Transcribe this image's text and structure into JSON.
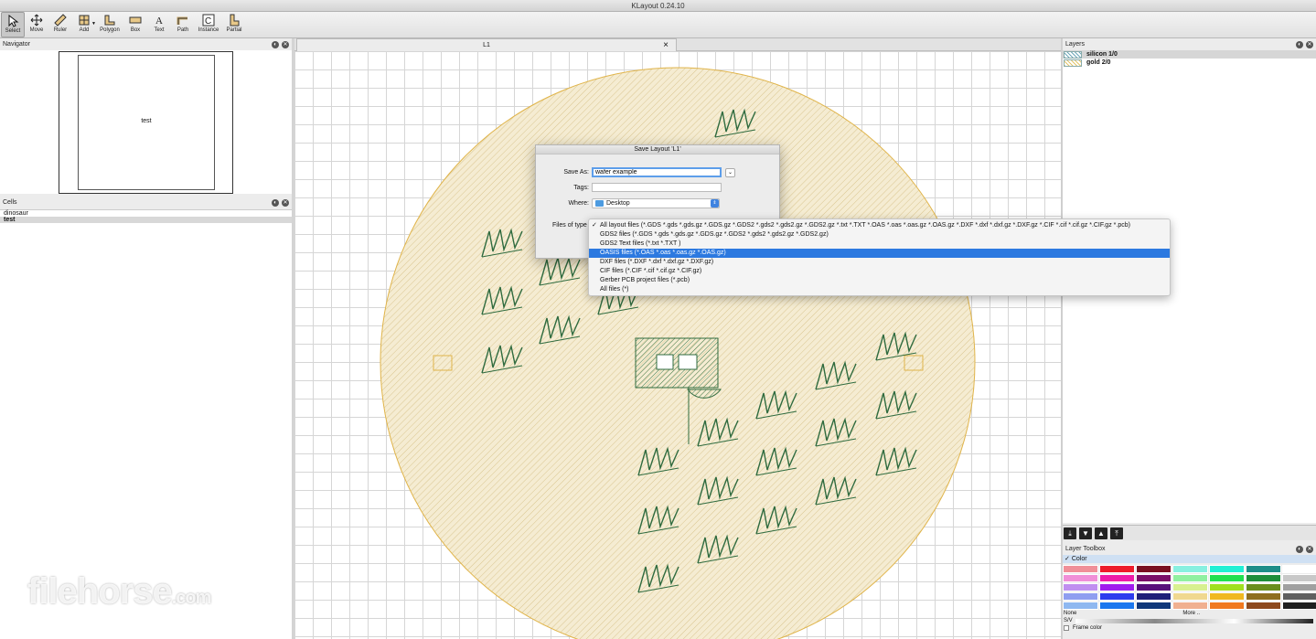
{
  "window": {
    "title": "KLayout 0.24.10"
  },
  "toolbar": {
    "tools": [
      {
        "label": "Select",
        "icon": "arrow-cursor-icon",
        "active": true
      },
      {
        "label": "Move",
        "icon": "move-icon"
      },
      {
        "label": "Ruler",
        "icon": "ruler-icon"
      },
      {
        "label": "Add",
        "icon": "add-grid-icon"
      },
      {
        "label": "Polygon",
        "icon": "polygon-icon"
      },
      {
        "label": "Box",
        "icon": "box-icon"
      },
      {
        "label": "Text",
        "icon": "text-icon"
      },
      {
        "label": "Path",
        "icon": "path-icon"
      },
      {
        "label": "Instance",
        "icon": "instance-icon"
      },
      {
        "label": "Partial",
        "icon": "partial-icon"
      }
    ]
  },
  "navigator": {
    "title": "Navigator",
    "cell_label": "test"
  },
  "cells": {
    "title": "Cells",
    "items": [
      {
        "name": "dinosaur",
        "selected": false
      },
      {
        "name": "test",
        "selected": true
      }
    ]
  },
  "layout_tab": {
    "label": "L1",
    "close": "×"
  },
  "layers": {
    "title": "Layers",
    "items": [
      {
        "name": "silicon 1/0",
        "color": "#6fa8b8",
        "selected": true
      },
      {
        "name": "gold 2/0",
        "color": "#e2c56b",
        "selected": false
      }
    ],
    "buttons": [
      "⤓",
      "▼",
      "▲",
      "⤒"
    ]
  },
  "layer_toolbox": {
    "title": "Layer Toolbox",
    "color_section": "Color",
    "palette": [
      "#f08f98",
      "#ee1c2a",
      "#7a1020",
      "#88f0e0",
      "#21f0d4",
      "#1e8e88",
      "#ffffff",
      "#f08fd8",
      "#ee1ca8",
      "#7a1068",
      "#90f0a0",
      "#21e050",
      "#1e8e3a",
      "#c8c8c8",
      "#c08ff0",
      "#a01cee",
      "#58107a",
      "#d8f090",
      "#a0e020",
      "#6a8e1e",
      "#a0a0a0",
      "#8f9ef0",
      "#2c3cee",
      "#1e207a",
      "#f0d890",
      "#f0b820",
      "#8e6e1e",
      "#606060",
      "#8fb8f0",
      "#1c78ee",
      "#10387a",
      "#f0b090",
      "#f07a20",
      "#8e4a1e",
      "#202020"
    ],
    "none_label": "None",
    "more_label": "More ..",
    "sv_label": "S/V",
    "frame_color_label": "Frame color"
  },
  "save_dialog": {
    "title": "Save Layout 'L1'",
    "save_as_label": "Save As:",
    "save_as_value": "wafer example",
    "tags_label": "Tags:",
    "where_label": "Where:",
    "where_value": "Desktop",
    "files_of_type_label": "Files of type"
  },
  "file_types": {
    "options": [
      {
        "text": "All layout files (*.GDS *.gds *.gds.gz *.GDS.gz *.GDS2 *.gds2 *.gds2.gz *.GDS2.gz *.txt *.TXT *.OAS *.oas *.oas.gz *.OAS.gz *.DXF *.dxf *.dxf.gz *.DXF.gz *.CIF *.cif *.cif.gz *.CIF.gz *.pcb)",
        "checked": true
      },
      {
        "text": "GDS2 files (*.GDS *.gds *.gds.gz *.GDS.gz *.GDS2 *.gds2 *.gds2.gz *.GDS2.gz)"
      },
      {
        "text": "GDS2 Text files (*.txt *.TXT )"
      },
      {
        "text": "OASIS files (*.OAS *.oas *.oas.gz *.OAS.gz)",
        "highlighted": true
      },
      {
        "text": "DXF files (*.DXF *.dxf *.dxf.gz *.DXF.gz)"
      },
      {
        "text": "CIF files (*.CIF *.cif *.cif.gz *.CIF.gz)"
      },
      {
        "text": "Gerber PCB project files (*.pcb)"
      },
      {
        "text": "All files (*)"
      }
    ]
  },
  "watermark": {
    "text": "filehorse",
    "suffix": ".com"
  }
}
